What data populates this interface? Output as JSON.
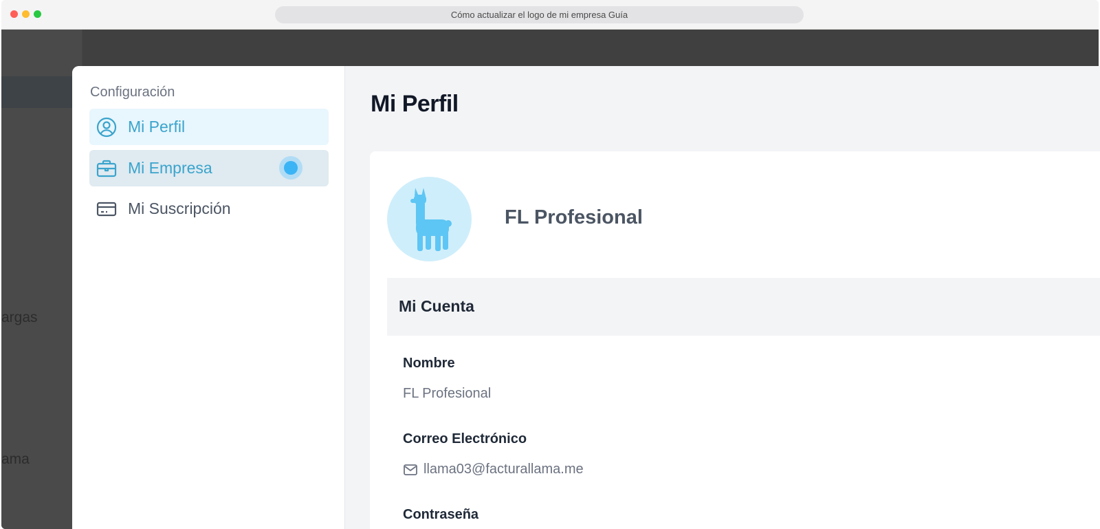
{
  "browser": {
    "url_title": "Cómo actualizar el logo de mi empresa Guía"
  },
  "background_app": {
    "sidebar_fragment_1": "argas",
    "sidebar_fragment_2": "ama"
  },
  "settings": {
    "heading": "Configuración",
    "nav": [
      {
        "label": "Mi Perfil",
        "icon": "user-circle-icon"
      },
      {
        "label": "Mi Empresa",
        "icon": "briefcase-icon"
      },
      {
        "label": "Mi Suscripción",
        "icon": "credit-card-icon"
      }
    ]
  },
  "profile": {
    "page_title": "Mi Perfil",
    "avatar_icon": "llama-icon",
    "company_name": "FL Profesional",
    "section_title": "Mi Cuenta",
    "fields": {
      "name_label": "Nombre",
      "name_value": "FL Profesional",
      "email_label": "Correo Electrónico",
      "email_value": "llama03@facturallama.me",
      "password_label": "Contraseña"
    }
  },
  "colors": {
    "accent": "#3aa4cc",
    "click_marker": "#3bb4f5",
    "avatar_bg": "#cfeefb",
    "llama": "#5ec6f4"
  }
}
